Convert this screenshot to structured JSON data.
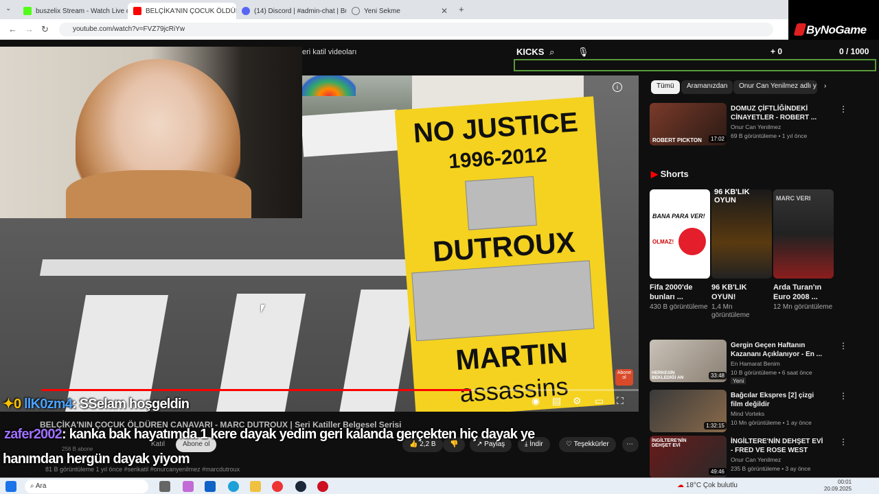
{
  "browser": {
    "tabs": [
      {
        "label": "buszelix Stream - Watch Live o",
        "color": "#53fc18"
      },
      {
        "label": "BELÇİKA'NIN ÇOCUK ÖLDÜREN",
        "color": "#ff0000"
      },
      {
        "label": "(14) Discord | #admin-chat | Bu",
        "color": "#5865f2"
      },
      {
        "label": "Yeni Sekme",
        "color": "#777777"
      }
    ],
    "url": "youtube.com/watch?v=FVZ79jcRiYw"
  },
  "brand": {
    "name": "ByNoGame"
  },
  "overlay": {
    "kicks_label": "KICKS",
    "counter": "0 / 1000",
    "plus_count": "0"
  },
  "youtube": {
    "search_text": "eri katil videoları",
    "video_title": "BELÇİKA'NIN ÇOCUK ÖLDÜREN CANAVARI - MARC DUTROUX | Seri Katiller Belgesel Serisi",
    "channel_subs": "258 B abone",
    "join_label": "Katıl",
    "subscribe_label": "Abone ol",
    "likes": "2,2 B",
    "share_label": "Paylaş",
    "download_label": "İndir",
    "thanks_label": "Teşekkürler",
    "view_line": "81 B görüntüleme  1 yıl önce  #serikatil #onurcanyenilmez #marcdutroux",
    "progress": 0.72,
    "watermark": "Abone ol",
    "sign": {
      "line1": "NO JUSTICE",
      "line2": "1996-2012",
      "line3": "DUTROUX",
      "line4": "MARTIN",
      "line5": "assassins"
    }
  },
  "chips": [
    "Tümü",
    "Aramanızdan",
    "Onur Can Yenilmez adlı y"
  ],
  "recommended": [
    {
      "title": "DOMUZ ÇİFTLİĞİNDEKİ CİNAYETLER - ROBERT ...",
      "channel": "Onur Can Yenilmez",
      "meta": "69 B görüntüleme • 1 yıl önce",
      "duration": "17:02",
      "thumb_text": "ROBERT PICKTON"
    },
    {
      "title": "Gergin Geçen Haftanın Kazananı Açıklanıyor - En ...",
      "channel": "En Hamarat Benim",
      "meta": "10 B görüntüleme • 6 saat önce",
      "badge": "Yeni",
      "duration": "33:48",
      "thumb_text": "HERKESİN BEKLEDİĞİ AN"
    },
    {
      "title": "Bağcılar Ekspres [2] çizgi film değildir",
      "channel": "Mind Vorteks",
      "meta": "10 Mn görüntüleme • 1 ay önce",
      "duration": "1:32:15",
      "thumb_text": ""
    },
    {
      "title": "İNGİLTERE'NİN DEHŞET EVİ - FRED VE ROSE WEST",
      "channel": "Onur Can Yenilmez",
      "meta": "235 B görüntüleme • 3 ay önce",
      "duration": "49:46",
      "thumb_text": "İNGİLTERE'NİN DEHŞET EVİ"
    }
  ],
  "shorts": {
    "heading": "Shorts",
    "items": [
      {
        "title": "Fifa 2000'de bunları ...",
        "views": "430 B görüntüleme",
        "thumb_top": "BANA PARA VER!",
        "thumb_bottom": "OLMAZ!"
      },
      {
        "title": "96 KB'LIK OYUN!",
        "views": "1,4 Mn görüntüleme",
        "thumb_top": "96 KB'LIK OYUN",
        "thumb_bottom": ""
      },
      {
        "title": "Arda Turan'ın Euro 2008 ...",
        "views": "12 Mn görüntüleme",
        "thumb_top": "MARC VERI",
        "thumb_bottom": ""
      }
    ]
  },
  "chat": [
    {
      "user": "llK0zm4",
      "user_color": "#4aa3ff",
      "message": ": SSelam hoşgeldin"
    },
    {
      "user": "zafer2002",
      "user_color": "#a070ff",
      "message": ": kanka bak hayatımda 1 kere dayak yedim geri kalanda gerçekten hiç dayak ye"
    },
    {
      "user": "",
      "user_color": "#ffffff",
      "message": "hanımdan hergün dayak yiyom"
    }
  ],
  "taskbar": {
    "search": "Ara",
    "weather": "18°C  Çok bulutlu",
    "time": "00:01",
    "date": "20.09.2025"
  }
}
